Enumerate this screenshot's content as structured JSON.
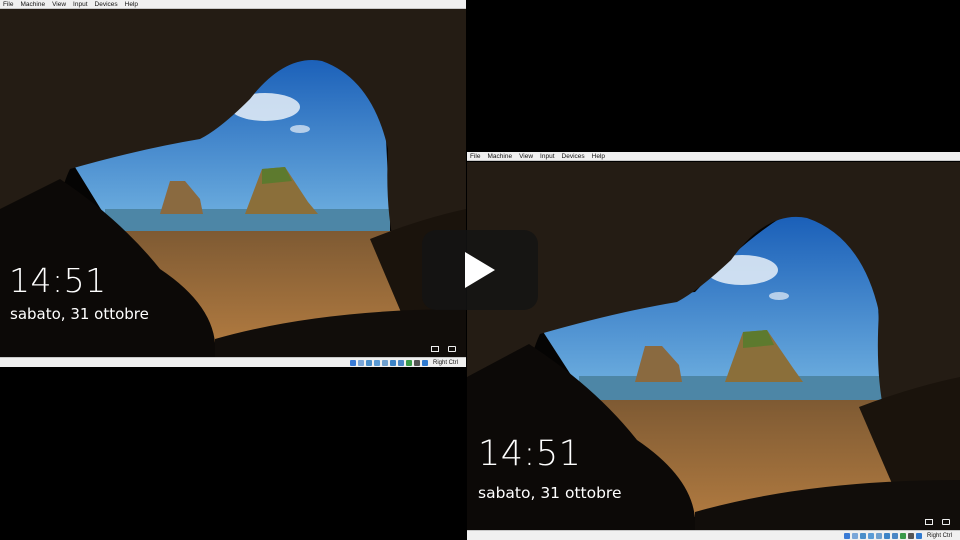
{
  "vm_left": {
    "menu": [
      "File",
      "Machine",
      "View",
      "Input",
      "Devices",
      "Help"
    ],
    "lockscreen": {
      "time": "14:51",
      "date": "sabato, 31 ottobre"
    },
    "status": {
      "host_key": "Right Ctrl"
    }
  },
  "vm_right": {
    "menu": [
      "File",
      "Machine",
      "View",
      "Input",
      "Devices",
      "Help"
    ],
    "lockscreen": {
      "time": "14:51",
      "date": "sabato, 31 ottobre"
    },
    "status": {
      "host_key": "Right Ctrl"
    }
  },
  "icons": {
    "lockscreen": [
      "network-icon",
      "power-icon"
    ],
    "statusbar": [
      "hard-disk-icon",
      "optical-drive-icon",
      "audio-icon",
      "network-adapter-icon",
      "usb-icon",
      "shared-folder-icon",
      "display-icon",
      "video-capture-icon",
      "cpu-icon",
      "mouse-integration-icon"
    ]
  },
  "colors": {
    "sky": "#2a78c8",
    "sand": "#9a6a35",
    "sea": "#4d86a6",
    "menubar": "#f0f0f0",
    "overlay": "#141414"
  }
}
